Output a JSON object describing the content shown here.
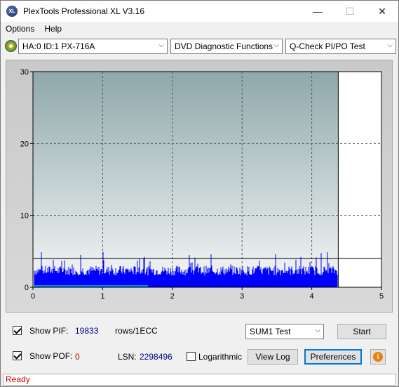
{
  "window": {
    "title": "PlexTools Professional XL V3.16",
    "icon_label": "XL",
    "minimize_glyph": "—",
    "maximize_glyph": "☐",
    "close_glyph": "✕"
  },
  "menu": {
    "items": [
      "Options",
      "Help"
    ]
  },
  "toolbar": {
    "drive_select": "HA:0 ID:1  PX-716A",
    "function_select": "DVD Diagnostic Functions",
    "test_select": "Q-Check PI/PO Test",
    "arrow_glyph": "⌵"
  },
  "chart_data": {
    "type": "bar",
    "title": "",
    "xlabel": "",
    "ylabel": "",
    "xlim": [
      0,
      5
    ],
    "ylim": [
      0,
      30
    ],
    "x_ticks": [
      "0",
      "1",
      "2",
      "3",
      "4",
      "5"
    ],
    "y_ticks": [
      "0",
      "10",
      "20",
      "30"
    ],
    "grid": true,
    "scan_end": 4.38,
    "threshold": 4,
    "series": [
      {
        "color": "#0000ff",
        "baseline_level": 3,
        "max": 5
      },
      {
        "color": "#00c8c8",
        "level_low": 0.2
      }
    ]
  },
  "controls": {
    "show_pif_label": "Show PIF:",
    "show_pif_checked": true,
    "pif_value": "19833",
    "pif_unit": "rows/1ECC",
    "show_pof_label": "Show POF:",
    "show_pof_checked": true,
    "pof_value": "0",
    "lsn_label": "LSN:",
    "lsn_value": "2298496",
    "logarithmic_label": "Logarithmic",
    "logarithmic_checked": false,
    "test_mode": "SUM1 Test",
    "start_label": "Start",
    "view_log_label": "View Log",
    "preferences_label": "Preferences",
    "info_glyph": "i"
  },
  "status": {
    "text": "Ready",
    "color": "#cc0000"
  },
  "colors": {
    "pif_value": "#000080",
    "pof_value": "#cc0000",
    "lsn_value": "#000080",
    "plot_bg_top": "#8fa8ab",
    "plot_bg_bottom": "#f5f7f7"
  }
}
